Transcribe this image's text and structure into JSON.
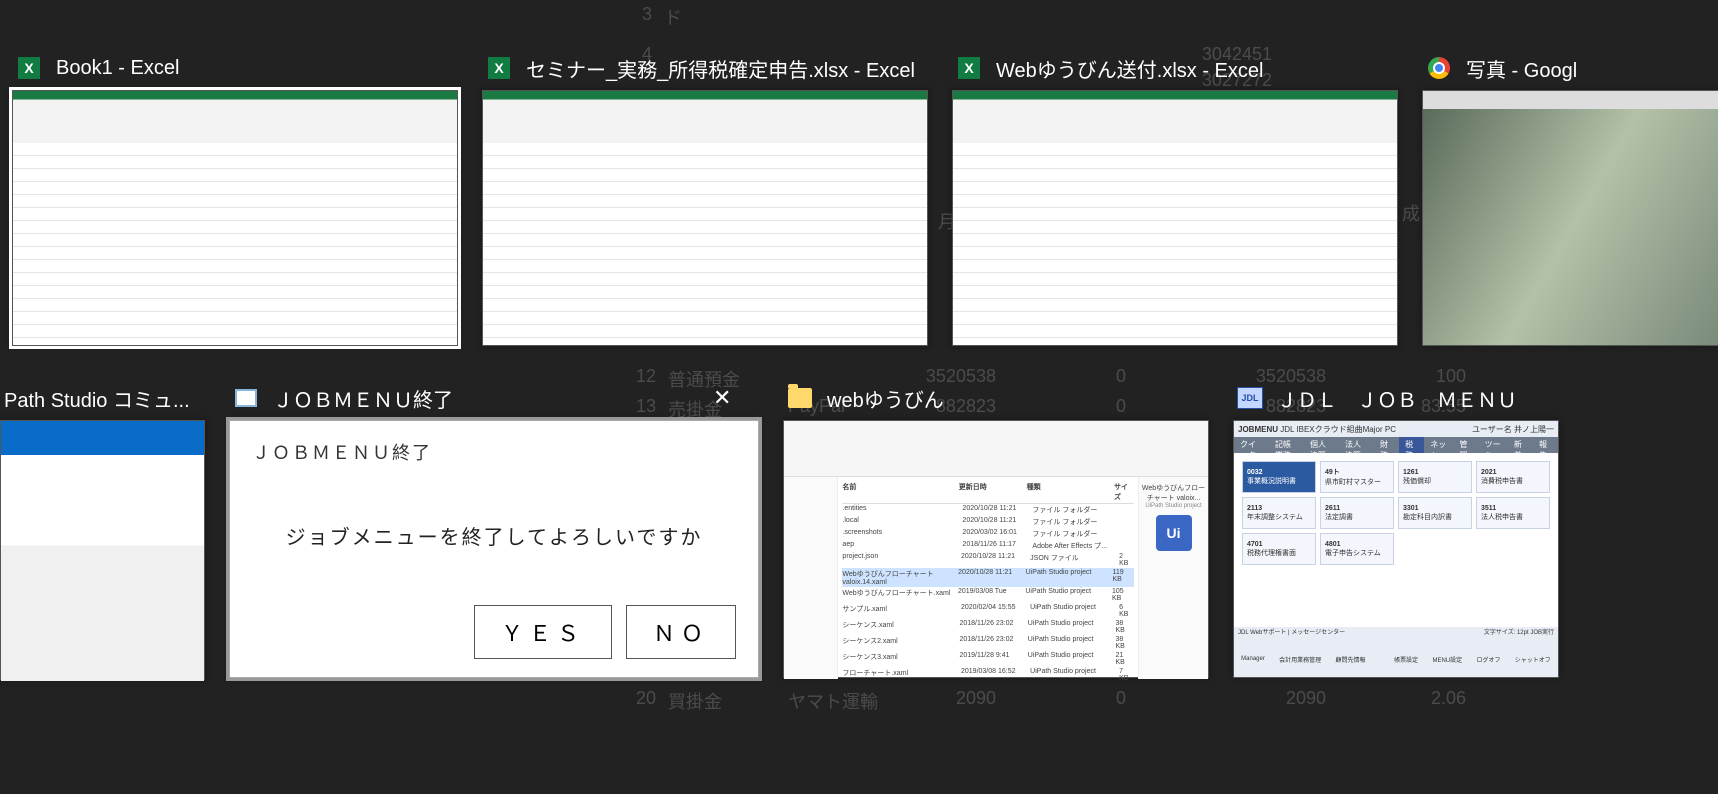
{
  "bg_cells": {
    "r1": {
      "n": "3",
      "t": "ド"
    },
    "r2": {
      "n": "4",
      "v1": "3042451"
    },
    "r3": {
      "n": "",
      "v1": "3027272"
    },
    "r4": {
      "t": "月",
      "t2": "成"
    },
    "r7": {
      "n": "12",
      "t": "普通預金",
      "v1": "3520538",
      "v2": "0",
      "v3": "3520538",
      "v4": "100"
    },
    "r8": {
      "n": "13",
      "t": "売掛金",
      "t2": "PayPal",
      "v1": "882823",
      "v2": "0",
      "v3": "882823",
      "v4": "83.55"
    },
    "r9": {
      "n": "20",
      "t": "買掛金",
      "t2": "ヤマト運輸",
      "v1": "2090",
      "v2": "0",
      "v3": "2090",
      "v4": "2.06"
    }
  },
  "tasks_row1": [
    {
      "icon": "excel",
      "title": "Book1 - Excel",
      "selected": true
    },
    {
      "icon": "excel",
      "title": "セミナー_実務_所得税確定申告.xlsx - Excel"
    },
    {
      "icon": "excel",
      "title": "Webゆうびん送付.xlsx - Excel"
    },
    {
      "icon": "chrome",
      "title": "写真 - Googl"
    }
  ],
  "tasks_row2": [
    {
      "icon": "uipath",
      "title": "Path Studio コミュ..."
    },
    {
      "icon": "win",
      "title": "ＪＯＢＭＥＮＵ終了",
      "close": true
    },
    {
      "icon": "folder",
      "title": "webゆうびん"
    },
    {
      "icon": "jdl",
      "title": "ＪＤＬ　ＪＯＢ　ＭＥＮＵ"
    }
  ],
  "dialog": {
    "title": "ＪＯＢＭＥＮＵ終了",
    "message": "ジョブメニューを終了してよろしいですか",
    "yes": "ＹＥＳ",
    "no": "ＮＯ"
  },
  "explorer": {
    "side_title": "Webゆうびんフローチャート valoix...",
    "side_sub": "UiPath Studio project",
    "badge": "Ui",
    "cols": [
      "名前",
      "更新日時",
      "種類",
      "サイズ"
    ],
    "rows": [
      {
        "n": ".entities",
        "d": "2020/10/28 11:21",
        "t": "ファイル フォルダー"
      },
      {
        "n": ".local",
        "d": "2020/10/28 11:21",
        "t": "ファイル フォルダー"
      },
      {
        "n": ".screenshots",
        "d": "2020/03/02 16:01",
        "t": "ファイル フォルダー"
      },
      {
        "n": "aep",
        "d": "2018/11/26 11:17",
        "t": "Adobe After Effects プ..."
      },
      {
        "n": "project.json",
        "d": "2020/10/28 11:21",
        "t": "JSON ファイル",
        "s": "2 KB"
      },
      {
        "n": "Webゆうびんフローチャート valoix.14.xaml",
        "d": "2020/10/28 11:21",
        "t": "UiPath Studio project",
        "s": "119 KB",
        "sel": true
      },
      {
        "n": "Webゆうびんフローチャート.xaml",
        "d": "2019/03/08 Tue",
        "t": "UiPath Studio project",
        "s": "105 KB"
      },
      {
        "n": "サンプル.xaml",
        "d": "2020/02/04 15:55",
        "t": "UiPath Studio project",
        "s": "6 KB"
      },
      {
        "n": "シーケンス.xaml",
        "d": "2018/11/26 23:02",
        "t": "UiPath Studio project",
        "s": "38 KB"
      },
      {
        "n": "シーケンス2.xaml",
        "d": "2018/11/26 23:02",
        "t": "UiPath Studio project",
        "s": "38 KB"
      },
      {
        "n": "シーケンス3.xaml",
        "d": "2019/11/28 9:41",
        "t": "UiPath Studio project",
        "s": "21 KB"
      },
      {
        "n": "フローチャート.xaml",
        "d": "2019/03/08 16:52",
        "t": "UiPath Studio project",
        "s": "7 KB"
      }
    ]
  },
  "jdl": {
    "header": "JOBMENU",
    "header2": "JDL IBEXクラウド組曲Major PC",
    "user": "ユーザー名 井ノ上陽一",
    "tabs": [
      "クイック",
      "記帳業務",
      "個人決算",
      "法人決算",
      "財 務",
      "税 務",
      "ネット",
      "管 理",
      "ツール",
      "新 着",
      "報 告"
    ],
    "active_tab": 5,
    "tiles": [
      {
        "c": "0032",
        "l": "事業概況説明書",
        "hl": true
      },
      {
        "c": "49ト",
        "l": "県市町村マスター"
      },
      {
        "c": "1261",
        "l": "残価償却"
      },
      {
        "c": "2021",
        "l": "消費税申告書"
      },
      {
        "c": "2113",
        "l": "年末調整システム"
      },
      {
        "c": "2611",
        "l": "法定調書"
      },
      {
        "c": "3301",
        "l": "勘定科目内訳書"
      },
      {
        "c": "3511",
        "l": "法人税申告書"
      },
      {
        "c": "4701",
        "l": "税務代理権書面"
      },
      {
        "c": "4801",
        "l": "電子申告システム"
      }
    ],
    "footer": [
      "Manager",
      "会計用業務管理",
      "顧問先情報",
      "",
      "帳票設定",
      "MENU設定",
      "ログオフ",
      "シャットオフ"
    ],
    "statusL": "JDL Webサポート",
    "statusL2": "メッセージセンター",
    "statusR": "文字サイズ: 12pt",
    "statusR2": "JOB実行"
  }
}
